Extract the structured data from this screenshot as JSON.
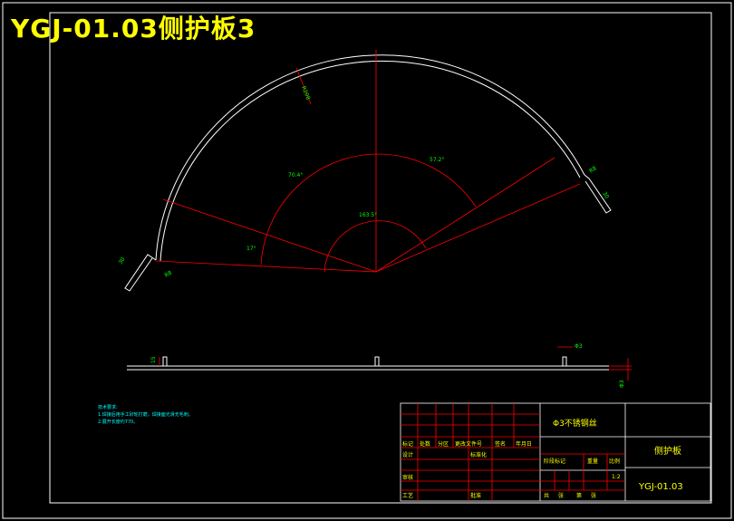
{
  "title": "YGJ-01.03侧护板3",
  "colors": {
    "background": "#000000",
    "frame": "#ffffff",
    "title": "#ffff00",
    "dimension": "#ff0000",
    "dimension_text": "#00ff00",
    "titleblock_grid": "#ff0000",
    "titleblock_text": "#ffff00",
    "notes": "#00ffff"
  },
  "dimensions": {
    "radius_outer": "R208",
    "angle_left": "70.4°",
    "angle_right": "57.2°",
    "angle_total": "163.5°",
    "angle_small_left": "17°",
    "angle_small_right": "18°",
    "end_left_len": "30",
    "end_left_r": "R8",
    "end_right_len": "30",
    "end_right_r": "R8",
    "phi": "Φ3",
    "height_15": "15",
    "height_phi3": "Φ3"
  },
  "notes": {
    "title": "技术要求:",
    "line1": "1.焊接后用手工砂轮打磨，焊接面光滑无毛刺。",
    "line2": "2.展开长度约770。"
  },
  "titleblock": {
    "material": "Φ3不锈钢丝",
    "part_name": "侧护板",
    "drawing_no": "YGJ-01.03",
    "scale": "1:2",
    "labels": {
      "mark": "标记",
      "count": "处数",
      "zone": "分区",
      "change_doc": "更改文件号",
      "sign": "签名",
      "date": "年月日",
      "design": "设计",
      "standard": "标准化",
      "review": "审核",
      "process": "工艺",
      "approve": "批准",
      "stage_mark": "阶段标记",
      "weight": "重量",
      "scale": "比例",
      "total": "共",
      "sheets": "张",
      "page": "第",
      "sheet": "张"
    }
  }
}
